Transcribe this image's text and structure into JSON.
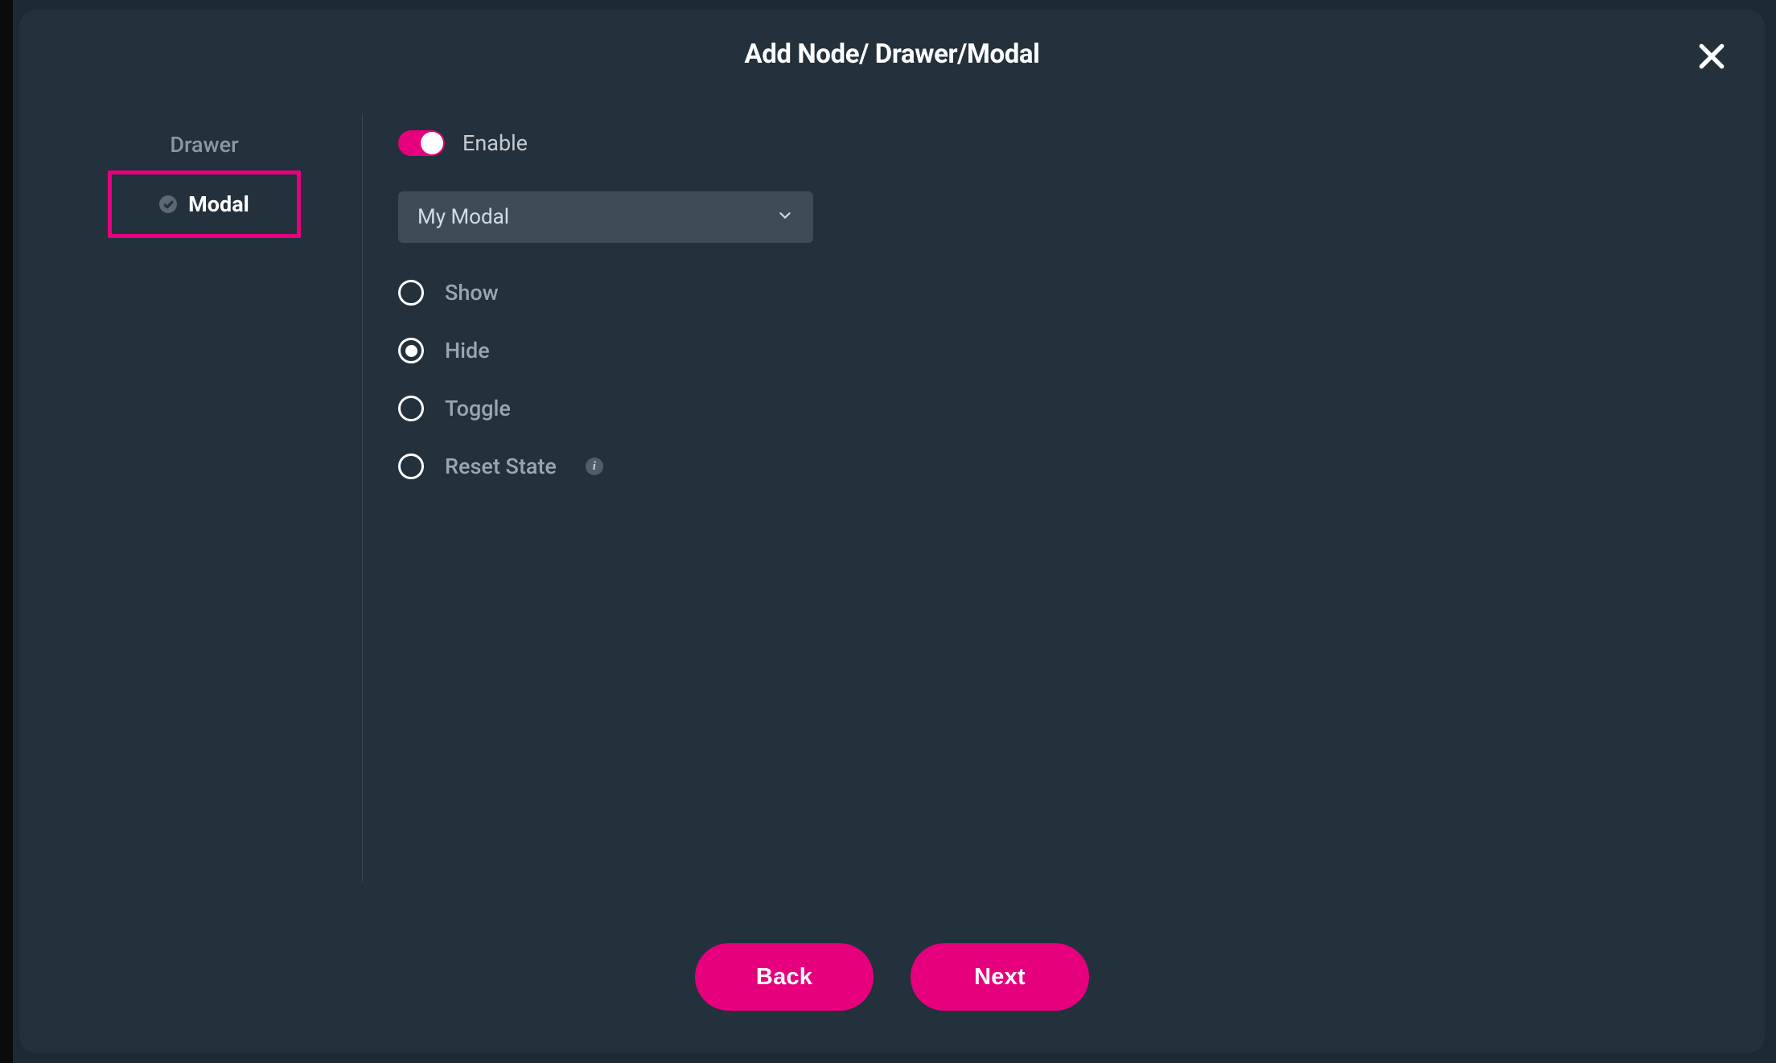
{
  "header": {
    "title": "Add Node/ Drawer/Modal"
  },
  "sidebar": {
    "items": [
      {
        "label": "Drawer",
        "selected": false
      },
      {
        "label": "Modal",
        "selected": true,
        "checked": true
      }
    ]
  },
  "form": {
    "enable_label": "Enable",
    "enable_value": true,
    "component_select": {
      "value": "My Modal"
    },
    "action_options": [
      {
        "label": "Show",
        "selected": false
      },
      {
        "label": "Hide",
        "selected": true
      },
      {
        "label": "Toggle",
        "selected": false
      },
      {
        "label": "Reset State",
        "selected": false,
        "info": true
      }
    ]
  },
  "footer": {
    "back_label": "Back",
    "next_label": "Next"
  },
  "colors": {
    "accent": "#e6007e",
    "surface": "#22313c",
    "input_bg": "#3d4c57"
  },
  "info_glyph": "i"
}
